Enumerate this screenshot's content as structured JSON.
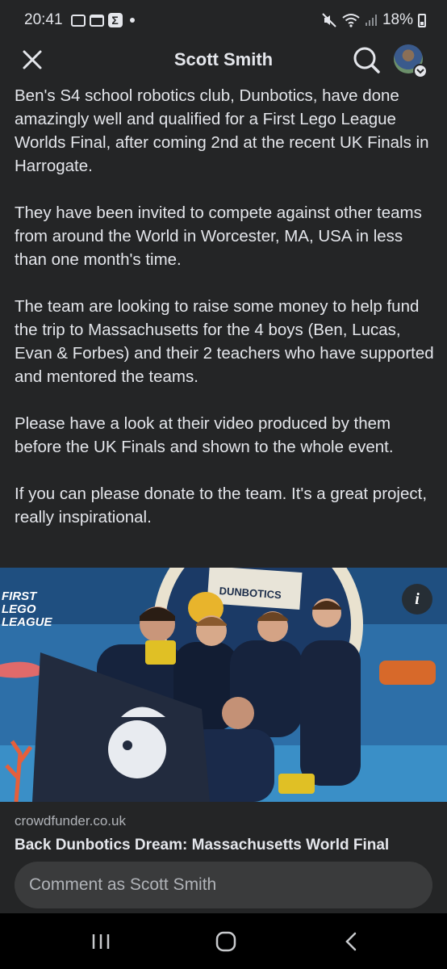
{
  "status_bar": {
    "time": "20:41",
    "battery": "18%",
    "icons": [
      "sms-icon",
      "calendar-icon",
      "sigma-icon",
      "dot-icon",
      "mute-icon",
      "wifi-icon",
      "signal-icon",
      "battery-icon"
    ]
  },
  "header": {
    "title": "Scott Smith",
    "icons": [
      "close-icon",
      "search-icon",
      "avatar"
    ]
  },
  "post": {
    "paragraphs": [
      "Ben's S4 school robotics club, Dunbotics, have done amazingly well and qualified for a First Lego League Worlds Final, after coming 2nd at the recent UK Finals in Harrogate.",
      "They have been invited to compete against other teams from around the World in Worcester, MA, USA in less than one month's time.",
      "The team are looking to raise some money to help fund the trip to Massachusetts for the 4 boys (Ben, Lucas, Evan & Forbes) and their 2 teachers who have supported and mentored the teams.",
      "Please have a look at their video produced by them before the UK Finals and shown to the whole event.",
      "If you can please donate to the team. It's a great project, really inspirational."
    ]
  },
  "link_card": {
    "image_text": {
      "first": "FIRST",
      "lego": "LEGO",
      "league": "LEAGUE",
      "banner": "DUNBOTICS"
    },
    "info_label": "i",
    "domain": "crowdfunder.co.uk",
    "title": "Back Dunbotics Dream: Massachusetts World Final"
  },
  "comment": {
    "placeholder": "Comment as Scott Smith"
  },
  "nav_bar": {
    "icons": [
      "recent-apps-icon",
      "home-icon",
      "back-icon"
    ]
  },
  "colors": {
    "background": "#242526",
    "text": "#e4e6eb",
    "secondary_text": "#b0b3b8",
    "input_bg": "#3a3b3c",
    "nav_bg": "#000000"
  }
}
